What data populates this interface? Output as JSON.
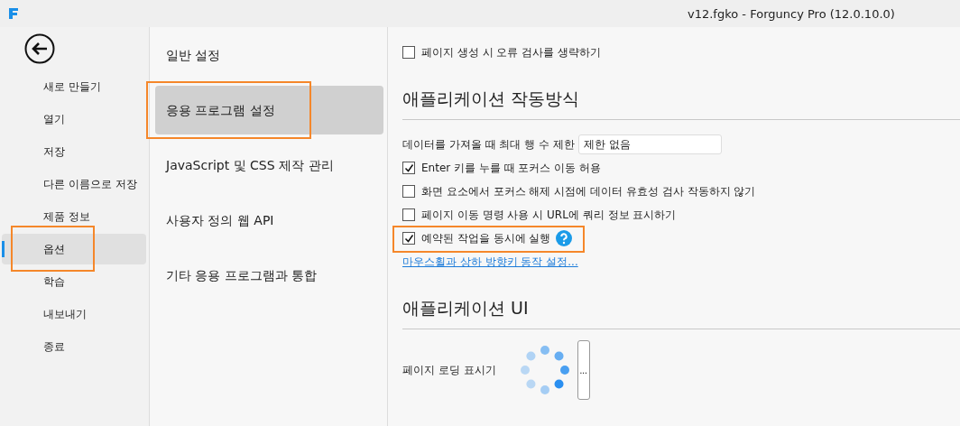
{
  "window": {
    "title": "v12.fgko - Forguncy Pro (12.0.10.0)"
  },
  "sidebar": {
    "items": [
      {
        "label": "새로 만들기",
        "selected": false,
        "highlighted": false
      },
      {
        "label": "열기",
        "selected": false,
        "highlighted": false
      },
      {
        "label": "저장",
        "selected": false,
        "highlighted": false
      },
      {
        "label": "다른 이름으로 저장",
        "selected": false,
        "highlighted": false
      },
      {
        "label": "제품 정보",
        "selected": false,
        "highlighted": false
      },
      {
        "label": "옵션",
        "selected": true,
        "highlighted": true
      },
      {
        "label": "학습",
        "selected": false,
        "highlighted": false
      },
      {
        "label": "내보내기",
        "selected": false,
        "highlighted": false
      },
      {
        "label": "종료",
        "selected": false,
        "highlighted": false
      }
    ]
  },
  "categories": {
    "items": [
      {
        "label": "일반 설정",
        "selected": false,
        "highlighted": false
      },
      {
        "label": "응용 프로그램 설정",
        "selected": true,
        "highlighted": true
      },
      {
        "label": "JavaScript 및 CSS 제작 관리",
        "selected": false,
        "highlighted": false
      },
      {
        "label": "사용자 정의 웹 API",
        "selected": false,
        "highlighted": false
      },
      {
        "label": "기타 응용 프로그램과 통합",
        "selected": false,
        "highlighted": false
      }
    ]
  },
  "settings": [
    {
      "kind": "checkbox",
      "label": "페이지 생성 시 오류 검사를 생략하기",
      "checked": false,
      "highlighted": false,
      "help": false
    },
    {
      "kind": "heading",
      "label": "애플리케이션 작동방식"
    },
    {
      "kind": "field",
      "label": "데이터를 가져올 때 최대 행 수 제한",
      "value": "제한 없음"
    },
    {
      "kind": "checkbox",
      "label": "Enter 키를 누를 때 포커스 이동 허용",
      "checked": true,
      "highlighted": false,
      "help": false
    },
    {
      "kind": "checkbox",
      "label": "화면 요소에서 포커스 해제 시점에 데이터 유효성 검사 작동하지 않기",
      "checked": false,
      "highlighted": false,
      "help": false
    },
    {
      "kind": "checkbox",
      "label": "페이지 이동 명령 사용 시 URL에 쿼리 정보 표시하기",
      "checked": false,
      "highlighted": false,
      "help": false
    },
    {
      "kind": "checkbox",
      "label": "예약된 작업을 동시에 실행",
      "checked": true,
      "highlighted": true,
      "help": true
    },
    {
      "kind": "link",
      "label": "마우스휠과 상하 방향키 동작 설정..."
    },
    {
      "kind": "heading",
      "label": "애플리케이션 UI"
    },
    {
      "kind": "loader",
      "label": "페이지 로딩 표시기",
      "button": "..."
    }
  ]
}
